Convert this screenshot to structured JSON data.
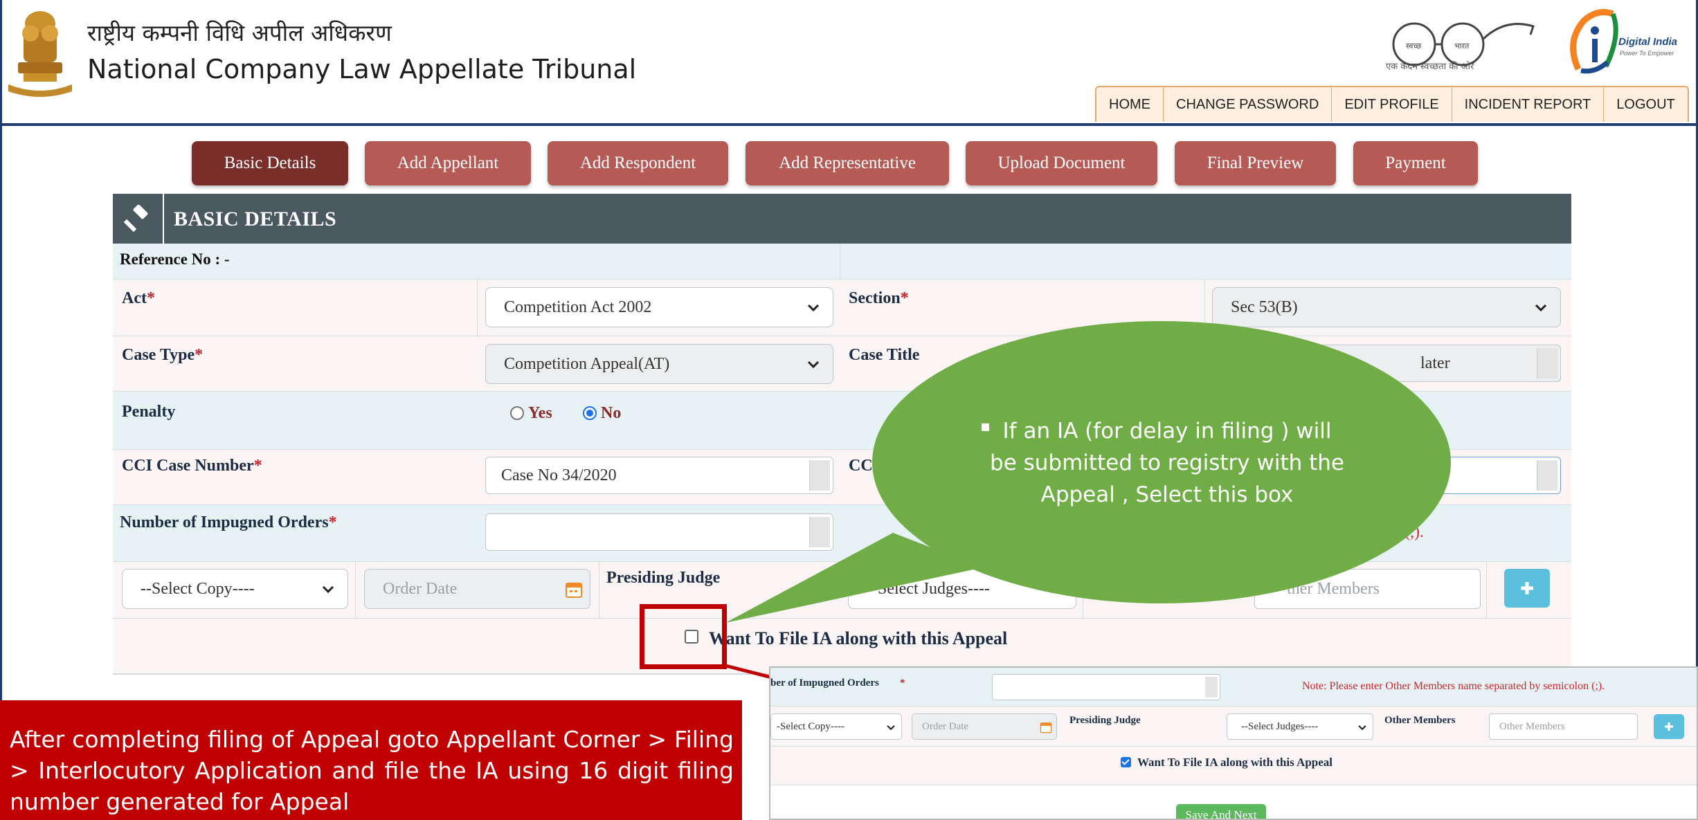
{
  "header": {
    "title_hindi": "राष्ट्रीय कम्पनी विधि अपील अधिकरण",
    "title_english": "National Company Law Appellate Tribunal",
    "swachh_tagline": "एक कदम स्वच्छता की ओर",
    "swachh_left": "स्वच्छ",
    "swachh_right": "भारत",
    "digital_india": "Digital India",
    "digital_india_sub": "Power To Empower"
  },
  "top_nav": [
    "HOME",
    "CHANGE PASSWORD",
    "EDIT PROFILE",
    "INCIDENT REPORT",
    "LOGOUT"
  ],
  "steps": [
    "Basic Details",
    "Add Appellant",
    "Add Respondent",
    "Add Representative",
    "Upload Document",
    "Final Preview",
    "Payment"
  ],
  "active_step": "Basic Details",
  "panel": {
    "title": "BASIC DETAILS",
    "reference_label": "Reference No : -"
  },
  "form": {
    "act_label": "Act",
    "act_value": "Competition Act 2002",
    "section_label": "Section",
    "section_value": "Sec 53(B)",
    "case_type_label": "Case Type",
    "case_type_value": "Competition Appeal(AT)",
    "case_title_label": "Case Title",
    "case_title_value_fragment": "later",
    "penalty_label": "Penalty",
    "penalty_yes": "Yes",
    "penalty_no": "No",
    "penalty_selected": "No",
    "cci_case_number_label": "CCI Case Number",
    "cci_case_number_value": "Case No 34/2020",
    "cci_second_label_fragment": "CC",
    "impugned_orders_label": "Number of Impugned Orders",
    "note_fragment": "n (;).",
    "select_copy": "--Select Copy----",
    "order_date_placeholder": "Order Date",
    "presiding_judge_label": "Presiding Judge",
    "select_judges": "--Select Judges----",
    "other_members_fragment": "ther Members",
    "want_ia_label": "Want To File IA along with this Appeal",
    "required_mark": "*"
  },
  "inset": {
    "impugned_orders_label": "ber of Impugned Orders",
    "note": "Note: Please enter Other Members name separated by semicolon (;).",
    "select_copy": "-Select Copy----",
    "order_date_placeholder": "Order Date",
    "presiding_judge_label": "Presiding Judge",
    "select_judges": "--Select Judges----",
    "other_members_label": "Other Members",
    "other_members_placeholder": "Other Members",
    "want_ia_label": "Want To File IA along with this Appeal",
    "want_ia_checked": true,
    "save_button": "Save And Next"
  },
  "callouts": {
    "bubble_text": "If an IA (for delay in filing ) will be submitted to registry with the Appeal , Select this box",
    "bubble_bullet": "▪",
    "red_text": "After completing filing of Appeal goto Appellant Corner > Filing > Interlocutory Application and file the IA using 16 digit filing number generated for Appeal"
  },
  "colors": {
    "step_bg": "#b65a55",
    "step_active_bg": "#7a2e2a",
    "panel_header": "#4a5860",
    "row_teal": "#e6f2f3",
    "bubble_green": "#70ad47",
    "callout_red": "#c00000",
    "add_button": "#5bc0de",
    "save_button": "#5cb85c"
  },
  "icons": {
    "gavel": "gavel-icon",
    "chevron": "chevron-down-icon",
    "calendar": "calendar-icon",
    "plus": "plus-icon"
  }
}
